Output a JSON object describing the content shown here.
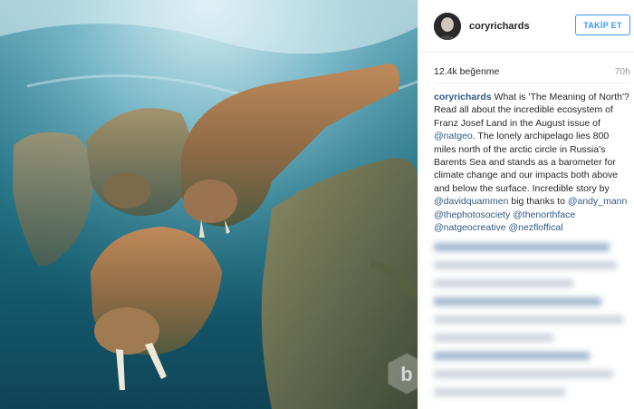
{
  "post": {
    "username": "coryrichards",
    "follow_label": "TAKİP ET",
    "likes": "12.4k beğenme",
    "time_ago": "70h",
    "caption": [
      {
        "type": "user",
        "text": "coryrichards"
      },
      {
        "type": "text",
        "text": " What is 'The Meaning of North'? Read all about the incredible ecosystem of Franz Josef Land in the August issue of "
      },
      {
        "type": "link",
        "text": "@natgeo"
      },
      {
        "type": "text",
        "text": ". The lonely archipelago lies 800 miles north of the arctic circle in Russia's Barents Sea and stands as a barometer for climate change and our impacts both above and below the surface. Incredible story by "
      },
      {
        "type": "link",
        "text": "@davidquammen"
      },
      {
        "type": "text",
        "text": " big thanks to "
      },
      {
        "type": "link",
        "text": "@andy_mann"
      },
      {
        "type": "text",
        "text": " "
      },
      {
        "type": "link",
        "text": "@thephotosociety"
      },
      {
        "type": "text",
        "text": " "
      },
      {
        "type": "link",
        "text": "@thenorthface"
      },
      {
        "type": "text",
        "text": " "
      },
      {
        "type": "link",
        "text": "@natgeocreative"
      },
      {
        "type": "text",
        "text": " "
      },
      {
        "type": "link",
        "text": "@nezfloffical"
      }
    ]
  },
  "colors": {
    "link": "#2d5a86",
    "follow": "#3897f0"
  },
  "icons": {
    "watermark": "b-logo-icon"
  }
}
